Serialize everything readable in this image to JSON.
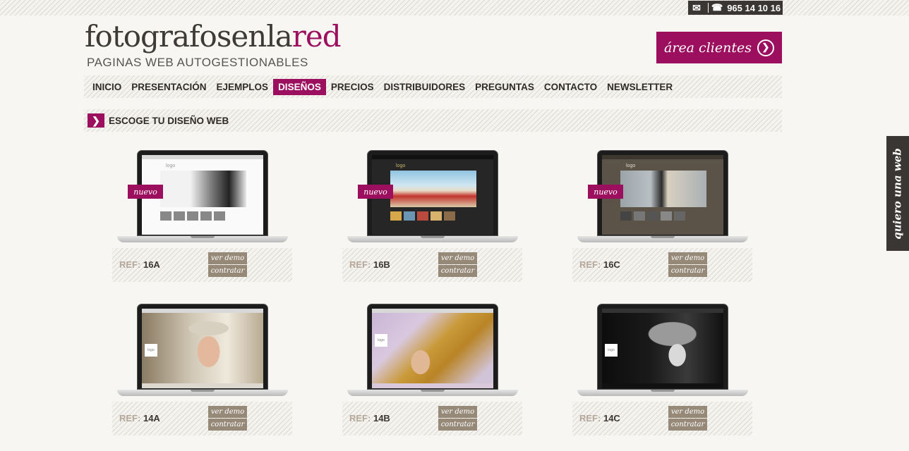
{
  "header": {
    "mail_icon": "✉",
    "phone_icon": "☎",
    "phone": "965 14 10 16",
    "logo_part1": "fotografosenla",
    "logo_part2": "red",
    "tagline": "PAGINAS WEB AUTOGESTIONABLES",
    "area_clientes": "área clientes",
    "area_arrow": "❯"
  },
  "nav": {
    "items": [
      "INICIO",
      "PRESENTACIÓN",
      "EJEMPLOS",
      "DISEÑOS",
      "PRECIOS",
      "DISTRIBUIDORES",
      "PREGUNTAS",
      "CONTACTO",
      "NEWSLETTER"
    ],
    "active": "DISEÑOS"
  },
  "section": {
    "chevron": "❯",
    "title": "ESCOGE TU DISEÑO WEB"
  },
  "side_tab": "quiero una web",
  "card_labels": {
    "ref_label": "REF:",
    "demo": "ver demo",
    "contratar": "contratar",
    "new_badge": "nuevo",
    "screen_logo": "logo"
  },
  "designs": [
    {
      "ref": "16A",
      "is_new": true,
      "theme": "light"
    },
    {
      "ref": "16B",
      "is_new": true,
      "theme": "dark"
    },
    {
      "ref": "16C",
      "is_new": true,
      "theme": "brown"
    },
    {
      "ref": "14A",
      "is_new": false,
      "theme": "portrait-headband"
    },
    {
      "ref": "14B",
      "is_new": false,
      "theme": "portrait-yellow"
    },
    {
      "ref": "14C",
      "is_new": false,
      "theme": "portrait-hat"
    }
  ],
  "colors": {
    "accent": "#9c0f5f",
    "dark": "#3a3633",
    "button": "#968978",
    "ref_label": "#b5a79a"
  }
}
